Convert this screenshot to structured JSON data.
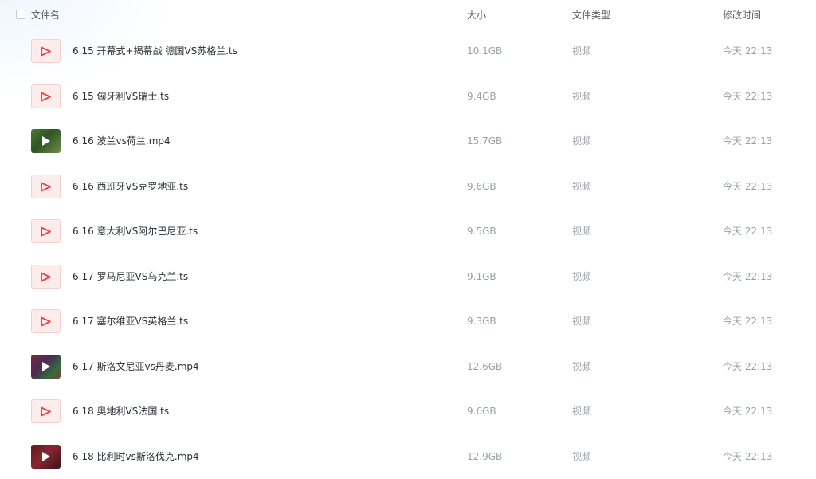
{
  "header": {
    "name": "文件名",
    "size": "大小",
    "type": "文件类型",
    "modified": "修改时间"
  },
  "files": [
    {
      "name": "6.15 开幕式+揭幕战 德国VS苏格兰.ts",
      "size": "10.1GB",
      "type": "视频",
      "modified": "今天 22:13",
      "icon": "video-file-icon"
    },
    {
      "name": "6.15 匈牙利VS瑞士.ts",
      "size": "9.4GB",
      "type": "视频",
      "modified": "今天 22:13",
      "icon": "video-file-icon"
    },
    {
      "name": "6.16 波兰vs荷兰.mp4",
      "size": "15.7GB",
      "type": "视频",
      "modified": "今天 22:13",
      "icon": "video-thumbnail"
    },
    {
      "name": "6.16 西班牙VS克罗地亚.ts",
      "size": "9.6GB",
      "type": "视频",
      "modified": "今天 22:13",
      "icon": "video-file-icon"
    },
    {
      "name": "6.16 意大利VS阿尔巴尼亚.ts",
      "size": "9.5GB",
      "type": "视频",
      "modified": "今天 22:13",
      "icon": "video-file-icon"
    },
    {
      "name": "6.17 罗马尼亚VS乌克兰.ts",
      "size": "9.1GB",
      "type": "视频",
      "modified": "今天 22:13",
      "icon": "video-file-icon"
    },
    {
      "name": "6.17 塞尔维亚VS英格兰.ts",
      "size": "9.3GB",
      "type": "视频",
      "modified": "今天 22:13",
      "icon": "video-file-icon"
    },
    {
      "name": "6.17 斯洛文尼亚vs丹麦.mp4",
      "size": "12.6GB",
      "type": "视频",
      "modified": "今天 22:13",
      "icon": "video-thumbnail"
    },
    {
      "name": "6.18 奥地利VS法国.ts",
      "size": "9.6GB",
      "type": "视频",
      "modified": "今天 22:13",
      "icon": "video-file-icon"
    },
    {
      "name": "6.18 比利时vs斯洛伐克.mp4",
      "size": "12.9GB",
      "type": "视频",
      "modified": "今天 22:13",
      "icon": "video-thumbnail"
    }
  ],
  "colors": {
    "accent_red": "#e8484a",
    "text_primary": "#2b2f36",
    "text_secondary": "#9aa0a8"
  }
}
